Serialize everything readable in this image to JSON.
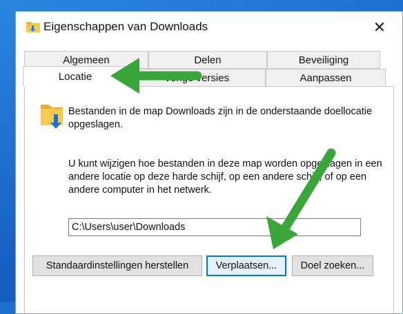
{
  "window": {
    "title": "Eigenschappen van Downloads",
    "close_glyph": "✕"
  },
  "tabs": {
    "row1": [
      "Algemeen",
      "Delen",
      "Beveiliging"
    ],
    "row2": [
      "Locatie",
      "Vorige versies",
      "Aanpassen"
    ],
    "active": "Locatie"
  },
  "content": {
    "description1": "Bestanden in de map Downloads zijn in de onderstaande doellocatie opgeslagen.",
    "description2": "U kunt wijzigen hoe bestanden in deze map worden opgeslagen in een andere locatie op deze harde schijf, op een andere schijf, of op een andere computer in het netwerk.",
    "path_value": "C:\\Users\\user\\Downloads"
  },
  "buttons": {
    "restore_default": "Standaardinstellingen herstellen",
    "move": "Verplaatsen...",
    "find_target": "Doel zoeken..."
  },
  "icons": {
    "title": "folder-download-icon",
    "content": "folder-download-icon",
    "annotation": "green-arrow"
  },
  "colors": {
    "arrow": "#3aa63a",
    "focus": "#0078d7",
    "folder": "#f3c14a",
    "download_arrow": "#1f6fd0"
  }
}
